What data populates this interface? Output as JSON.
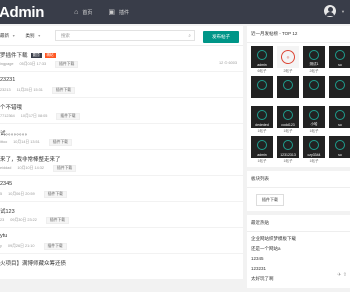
{
  "header": {
    "brand": "Admin",
    "nav": [
      {
        "label": "首页",
        "icon": "home-icon"
      },
      {
        "label": "插件",
        "icon": "plugin-icon"
      }
    ]
  },
  "filters": {
    "sort_label": "最新",
    "type_label": "类别",
    "search_placeholder": "搜索",
    "publish_label": "发布帖子"
  },
  "posts": [
    {
      "title": "罗插件下载",
      "meta1": "ingpage",
      "meta2": "05月03日 17:33",
      "tag": "插件下载",
      "stats": "12 ⊙ 6003",
      "badges": [
        "置顶",
        "精帖"
      ]
    },
    {
      "title": "23231",
      "meta1": "23213",
      "meta2": "11月25日 15:31",
      "tag": "插件下载",
      "stats": "",
      "badges": []
    },
    {
      "title": "个不错哦",
      "meta1": "7712364",
      "meta2": "10月17日 08:05",
      "tag": "插件下载",
      "stats": "",
      "badges": []
    },
    {
      "title": "试。。。。。。。。",
      "meta1": "ittoo",
      "meta2": "10月14日 13:51",
      "tag": "插件下载",
      "stats": "",
      "badges": []
    },
    {
      "title": "来了，我非常棒整走来了",
      "meta1": "eiddad",
      "meta2": "10月10日 14:32",
      "tag": "插件下载",
      "stats": "",
      "badges": []
    },
    {
      "title": "2345",
      "meta1": "5",
      "meta2": "10月06日 20:59",
      "tag": "插件下载",
      "stats": "",
      "badges": []
    },
    {
      "title": "试123",
      "meta1": "23",
      "meta2": "09月30日 23:22",
      "tag": "插件下载",
      "stats": "",
      "badges": []
    },
    {
      "title": "ytu",
      "meta1": "y",
      "meta2": "09月26日 21:10",
      "tag": "插件下载",
      "stats": "",
      "badges": []
    },
    {
      "title": "火项目】满博师藏众筹还债",
      "meta1": "",
      "meta2": "",
      "tag": "",
      "stats": "",
      "badges": []
    }
  ],
  "sidebar": {
    "top_title": "近一月发帖榜 - TOP 12",
    "top_users": [
      {
        "name": "admin",
        "count": "6帖子",
        "stamp": false
      },
      {
        "name": "",
        "count": "2帖子",
        "stamp": true
      },
      {
        "name": "测试1",
        "count": "2帖子",
        "stamp": false
      },
      {
        "name": "so",
        "count": "",
        "stamp": false
      },
      {
        "name": "",
        "count": "",
        "stamp": false
      },
      {
        "name": "",
        "count": "",
        "stamp": false
      },
      {
        "name": "",
        "count": "",
        "stamp": false
      },
      {
        "name": "",
        "count": "",
        "stamp": false
      },
      {
        "name": "dededed",
        "count": "1帖子",
        "stamp": false
      },
      {
        "name": "codd123",
        "count": "1帖子",
        "stamp": false
      },
      {
        "name": "小哈",
        "count": "1帖子",
        "stamp": false
      },
      {
        "name": "so",
        "count": "",
        "stamp": false
      },
      {
        "name": "admin",
        "count": "1帖子",
        "stamp": false
      },
      {
        "name": "12312313",
        "count": "1帖子",
        "stamp": false
      },
      {
        "name": "czy3344",
        "count": "1帖子",
        "stamp": false
      },
      {
        "name": "so",
        "count": "",
        "stamp": false
      }
    ],
    "category_title": "板块列表",
    "category_button": "插件下载",
    "hot_title": "最近热贴",
    "hot_posts": [
      "企业网站织梦模板下载",
      "还是一个网站a",
      "12345",
      "123231",
      "太好玩了啊"
    ]
  }
}
